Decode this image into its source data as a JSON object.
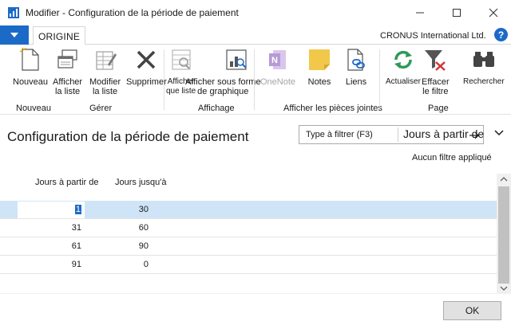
{
  "window": {
    "title": "Modifier - Configuration de la période de paiement"
  },
  "ribbon_tabs": {
    "active": "ORIGINE",
    "company": "CRONUS International Ltd."
  },
  "ribbon": {
    "buttons": {
      "nouveau": "Nouveau",
      "afficher_liste": "Afficher\nla liste",
      "modifier_liste": "Modifier\nla liste",
      "supprimer": "Supprimer",
      "afficher_liste_2": "Afficher\nque liste",
      "afficher_graphique": "Afficher sous forme\nde graphique",
      "onenote": "OneNote",
      "notes": "Notes",
      "liens": "Liens",
      "actualiser": "Actualiser",
      "effacer_filtre": "Effacer\nle filtre",
      "rechercher": "Rechercher"
    },
    "groups": {
      "nouveau": "Nouveau",
      "gerer": "Gérer",
      "affichage": "Affichage",
      "pieces_jointes": "Afficher les pièces jointes",
      "page": "Page"
    }
  },
  "page": {
    "title": "Configuration de la période de paiement",
    "filter_placeholder": "Type à filtrer (F3)",
    "filter_field": "Jours à partir de",
    "no_filter": "Aucun filtre appliqué"
  },
  "grid": {
    "columns": [
      "Jours à partir de",
      "Jours jusqu'à"
    ],
    "rows": [
      {
        "from": "1",
        "to": "30",
        "selected": true
      },
      {
        "from": "31",
        "to": "60",
        "selected": false
      },
      {
        "from": "61",
        "to": "90",
        "selected": false
      },
      {
        "from": "91",
        "to": "0",
        "selected": false
      }
    ]
  },
  "footer": {
    "ok_label": "OK"
  },
  "colors": {
    "accent": "#1c6ac7",
    "selected_row": "#cfe4f7",
    "green_refresh": "#2e9a57",
    "onenote_purple": "#8f5fb8",
    "notes_yellow": "#f2c84b"
  }
}
